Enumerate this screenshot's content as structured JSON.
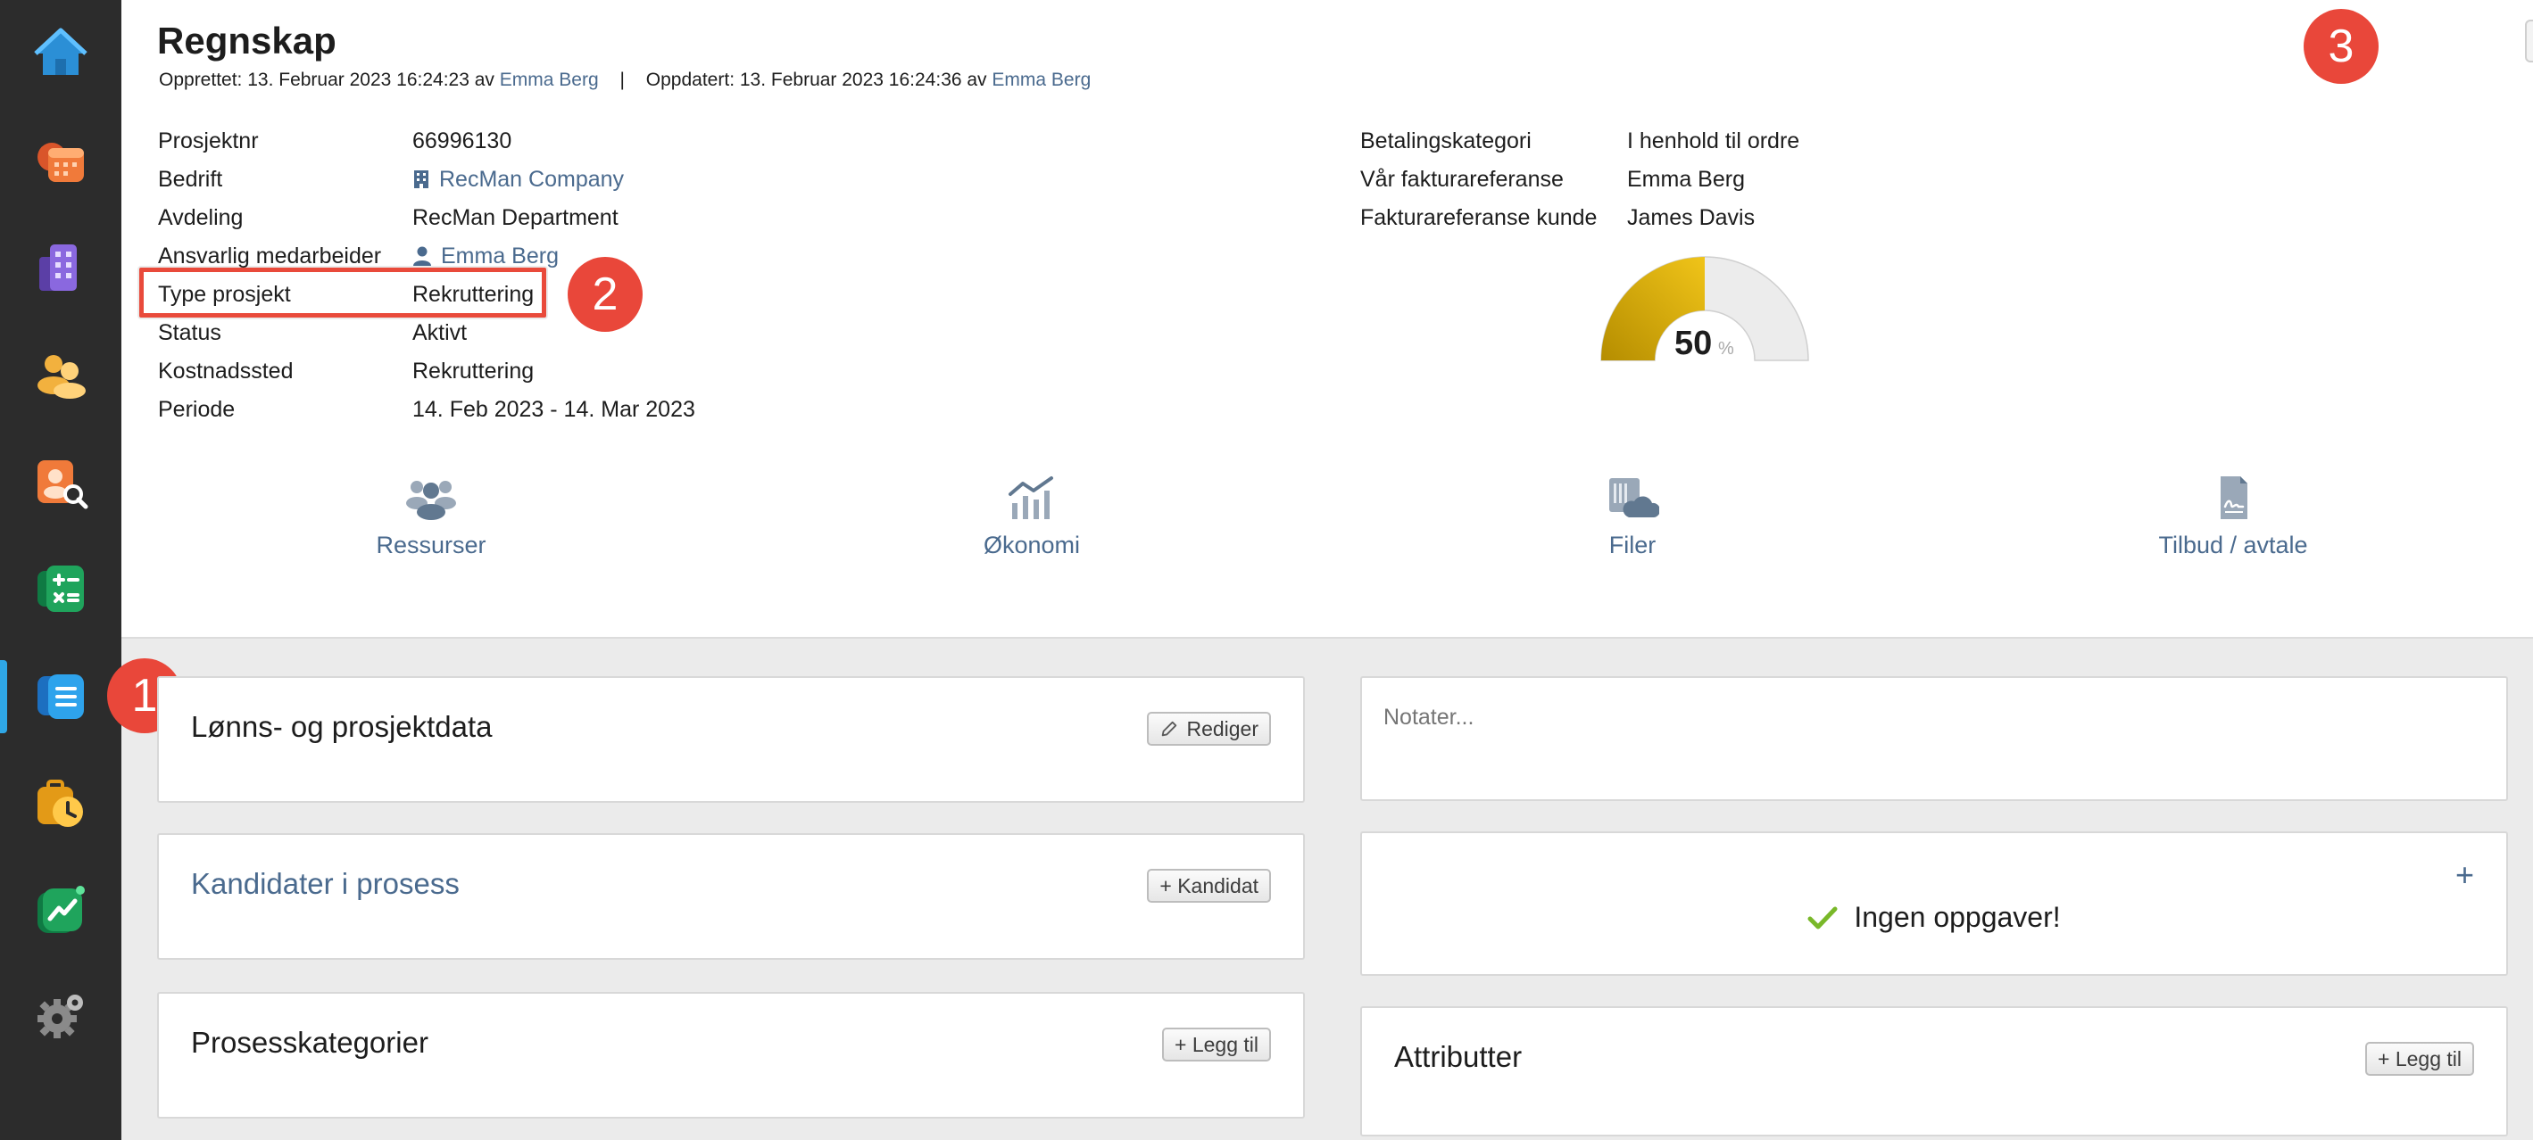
{
  "header": {
    "title": "Regnskap",
    "created_label": "Opprettet: 13. Februar 2023 16:24:23 av",
    "created_by": "Emma Berg",
    "separator": "|",
    "updated_label": "Oppdatert: 13. Februar 2023 16:24:36 av",
    "updated_by": "Emma Berg"
  },
  "details_left": [
    {
      "label": "Prosjektnr",
      "value": "66996130"
    },
    {
      "label": "Bedrift",
      "value": "RecMan Company"
    },
    {
      "label": "Avdeling",
      "value": "RecMan Department"
    },
    {
      "label": "Ansvarlig medarbeider",
      "value": "Emma Berg"
    },
    {
      "label": "Type prosjekt",
      "value": "Rekruttering"
    },
    {
      "label": "Status",
      "value": "Aktivt"
    },
    {
      "label": "Kostnadssted",
      "value": "Rekruttering"
    },
    {
      "label": "Periode",
      "value": "14. Feb 2023 - 14. Mar 2023"
    }
  ],
  "details_right": [
    {
      "label": "Betalingskategori",
      "value": "I henhold til ordre"
    },
    {
      "label": "Vår fakturareferanse",
      "value": "Emma Berg"
    },
    {
      "label": "Fakturareferanse kunde",
      "value": "James Davis"
    }
  ],
  "gauge": {
    "value": "50",
    "unit": "%",
    "fraction": 0.5,
    "fill_color": "#d4a900",
    "track_color": "#ececec"
  },
  "tiles": [
    {
      "label": "Ressurser",
      "icon": "people-icon"
    },
    {
      "label": "Økonomi",
      "icon": "chart-icon"
    },
    {
      "label": "Filer",
      "icon": "files-cloud-icon"
    },
    {
      "label": "Tilbud / avtale",
      "icon": "document-signature-icon"
    }
  ],
  "cards": {
    "lonn": {
      "title": "Lønns- og prosjektdata",
      "button": "Rediger"
    },
    "kandidater": {
      "title": "Kandidater i prosess",
      "button": "+ Kandidat"
    },
    "prosess": {
      "title": "Prosesskategorier",
      "button": "+ Legg til"
    },
    "notes": {
      "placeholder": "Notater..."
    },
    "tasks": {
      "empty_text": "Ingen oppgaver!",
      "add": "+"
    },
    "attributter": {
      "title": "Attributter",
      "button": "+ Legg til"
    }
  },
  "callouts": [
    "1",
    "2",
    "3"
  ],
  "sidebar": {
    "items": [
      "home-icon",
      "calendar-icon",
      "building-icon",
      "contacts-icon",
      "candidate-search-icon",
      "calculator-icon",
      "projects-list-icon",
      "timesheet-icon",
      "analytics-icon",
      "settings-icon"
    ],
    "active_index": 6
  },
  "colors": {
    "accent_link": "#4a6a8e",
    "callout": "#e9473a",
    "sidebar_bg": "#2c2c2c",
    "active_bar": "#2fa7e6"
  }
}
